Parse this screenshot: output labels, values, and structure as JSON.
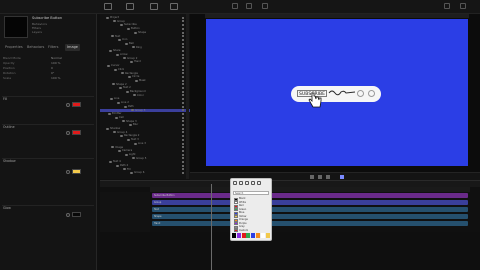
{
  "inspector": {
    "clip_title": "Subscribe Button",
    "meta": [
      "Behaviors",
      "Filters",
      "Layers"
    ],
    "tabs": [
      "Properties",
      "Behaviors",
      "Filters",
      "Image"
    ],
    "rows": [
      {
        "label": "Blend Mode",
        "value": "Normal"
      },
      {
        "label": "Opacity",
        "value": "100 %"
      },
      {
        "label": "Position",
        "value": "0"
      },
      {
        "label": "Rotation",
        "value": "0°"
      },
      {
        "label": "Scale",
        "value": "100 %"
      }
    ],
    "sections": [
      "Fill",
      "Outline",
      "Shadow",
      "Glow"
    ],
    "colors": {
      "fill": "#e01b1b",
      "outline": "#e01b1b",
      "shadow": "#f2c94c",
      "glow": "#080808"
    }
  },
  "layers": {
    "rows": [
      "Project",
      "Group",
      "Subscribe",
      "Button",
      "Shape",
      "Text",
      "Icon",
      "Bell",
      "Ring",
      "Share",
      "Arrow",
      "Group 2",
      "Hand",
      "Cursor",
      "Click",
      "Rectangle",
      "Circle",
      "Mask",
      "Shape 2",
      "Text 2",
      "Background",
      "Color",
      "Line",
      "Line 2",
      "Path",
      "Group 3",
      "Emitter",
      "Cell",
      "Shape 3",
      "Blur",
      "Shadow",
      "Group 4",
      "Rectangle 2",
      "Text 3",
      "Line 3",
      "Image",
      "Camera",
      "Light",
      "Group 5",
      "Text 4",
      "Path 2",
      "Fill",
      "Group 6"
    ],
    "selected_index": 25
  },
  "viewer": {
    "canvas_color": "#2b3ee6",
    "subscribe_label": "SUBSCRIBE",
    "cursor_caption": "CLICK"
  },
  "timeline": {
    "tracks": [
      {
        "label": "Subscribe Button",
        "color": "#6a2a8a"
      },
      {
        "label": "Group",
        "color": "#3a3f9a"
      },
      {
        "label": "Text",
        "color": "#25506e"
      },
      {
        "label": "Shape",
        "color": "#25506e"
      },
      {
        "label": "Hand",
        "color": "#25506e"
      }
    ]
  },
  "color_popup": {
    "search_placeholder": "Search",
    "items": [
      {
        "label": "Black",
        "color": "#000000"
      },
      {
        "label": "White",
        "color": "#ffffff"
      },
      {
        "label": "Red",
        "color": "#e01b1b"
      },
      {
        "label": "Green",
        "color": "#2fa84f"
      },
      {
        "label": "Blue",
        "color": "#2b3ee6"
      },
      {
        "label": "Yellow",
        "color": "#f2c94c"
      },
      {
        "label": "Orange",
        "color": "#f28c1b"
      },
      {
        "label": "Purple",
        "color": "#8a2be2"
      },
      {
        "label": "Gray",
        "color": "#8a8a8a"
      },
      {
        "label": "Custom",
        "color": "#e01b1b"
      }
    ],
    "swatches": [
      "#000000",
      "#8a2be2",
      "#e01b1b",
      "#2fa84f",
      "#2b3ee6",
      "#f28c1b",
      "#ffffff",
      "#f2c94c"
    ]
  }
}
